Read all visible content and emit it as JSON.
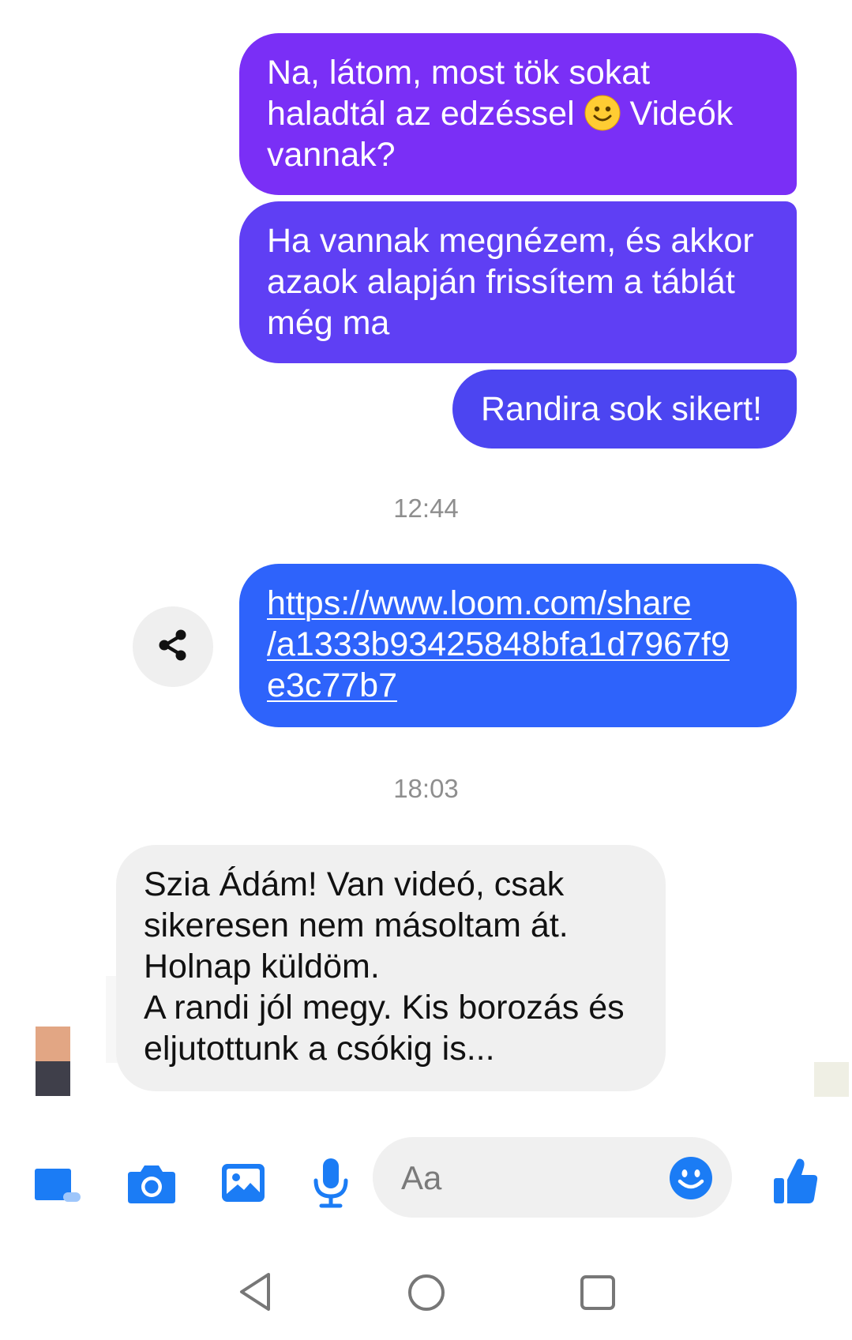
{
  "messages": [
    {
      "direction": "outgoing",
      "text_before_emoji": "Na, látom, most tök sokat\nhaladtál az edzéssel ",
      "emoji": "slightly-smiling-face-emoji",
      "text_after_emoji": " Videók\nvannak?"
    },
    {
      "direction": "outgoing",
      "text": "Ha vannak megnézem, és akkor\nazaok alapján frissítem a táblát\nmég ma"
    },
    {
      "direction": "outgoing",
      "text": "Randira sok sikert!"
    },
    {
      "direction": "outgoing",
      "link_text": "https://www.loom.com/share\n/a1333b93425848bfa1d7967f9\ne3c77b7"
    },
    {
      "direction": "incoming",
      "text": "Szia Ádám! Van videó, csak\nsikeresen nem másoltam át.\nHolnap küldöm.\nA randi jól megy. Kis borozás és\neljutottunk a csókig is..."
    }
  ],
  "timestamps": [
    "12:44",
    "18:03"
  ],
  "composer": {
    "placeholder": "Aa",
    "icons": [
      "menu-icon",
      "camera-icon",
      "gallery-icon",
      "microphone-icon",
      "emoji-icon",
      "thumbs-up-icon"
    ]
  },
  "nav_bar": {
    "icons": [
      "back-icon",
      "home-icon",
      "recents-icon"
    ]
  },
  "colors": {
    "bubble_1": "#7a2ff6",
    "bubble_2": "#5f3ff4",
    "bubble_3": "#4c45f1",
    "bubble_link": "#2e63fb",
    "bubble_incoming": "#f0f0f0",
    "accent": "#0a7cff"
  }
}
